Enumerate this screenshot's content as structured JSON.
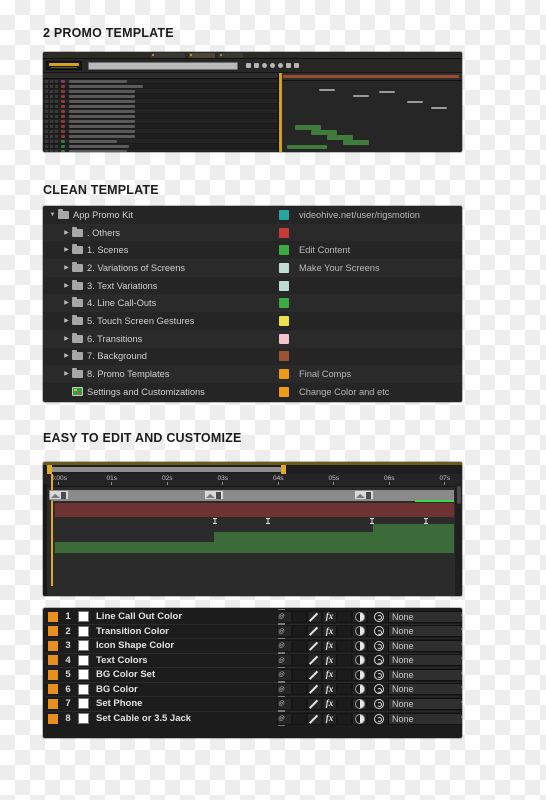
{
  "sections": [
    {
      "title": "2 PROMO TEMPLATE"
    },
    {
      "title": "CLEAN TEMPLATE"
    },
    {
      "title": "EASY TO EDIT AND CUSTOMIZE"
    }
  ],
  "ae_panel": {
    "time_display": "0:00:00:00",
    "tabs": [
      "",
      "",
      ""
    ]
  },
  "tree": {
    "rows": [
      {
        "arrow": "▼",
        "icon": "folder-icon",
        "label": "App Promo Kit",
        "swatch": "#27a5a0",
        "note": "videohive.net/user/rigsmotion",
        "indent": 1
      },
      {
        "arrow": "▶",
        "icon": "folder-icon",
        "label": ". Others",
        "swatch": "#c73b34",
        "note": "",
        "indent": 2
      },
      {
        "arrow": "▶",
        "icon": "folder-icon",
        "label": "1. Scenes",
        "swatch": "#3cab45",
        "note": "Edit Content",
        "indent": 2
      },
      {
        "arrow": "▶",
        "icon": "folder-icon",
        "label": "2. Variations of Screens",
        "swatch": "#bfdbd4",
        "note": "Make Your Screens",
        "indent": 2
      },
      {
        "arrow": "▶",
        "icon": "folder-icon",
        "label": "3. Text Variations",
        "swatch": "#bfdbd4",
        "note": "",
        "indent": 2
      },
      {
        "arrow": "▶",
        "icon": "folder-icon",
        "label": "4. Line Call-Outs",
        "swatch": "#3cab45",
        "note": "",
        "indent": 2
      },
      {
        "arrow": "▶",
        "icon": "folder-icon",
        "label": "5. Touch Screen Gestures",
        "swatch": "#e9e24c",
        "note": "",
        "indent": 2
      },
      {
        "arrow": "▶",
        "icon": "folder-icon",
        "label": "6. Transitions",
        "swatch": "#f2c3cd",
        "note": "",
        "indent": 2
      },
      {
        "arrow": "▶",
        "icon": "folder-icon",
        "label": "7. Background",
        "swatch": "#9a5333",
        "note": "",
        "indent": 2
      },
      {
        "arrow": "▶",
        "icon": "folder-icon",
        "label": "8. Promo Templates",
        "swatch": "#ef9a15",
        "note": "Final Comps",
        "indent": 2
      },
      {
        "arrow": "",
        "icon": "composition-icon",
        "label": "Settings and Customizations",
        "swatch": "#ef9a15",
        "note": "Change Color and etc",
        "indent": 2
      }
    ]
  },
  "timeline": {
    "ticks": [
      "0:00s",
      "01s",
      "02s",
      "03s",
      "04s",
      "05s",
      "06s",
      "07s"
    ]
  },
  "controls": {
    "rows": [
      {
        "num": "1",
        "label": "Line Call Out Color",
        "parent": "None"
      },
      {
        "num": "2",
        "label": "Transition Color",
        "parent": "None"
      },
      {
        "num": "3",
        "label": "Icon Shape Color",
        "parent": "None"
      },
      {
        "num": "4",
        "label": "Text Colors",
        "parent": "None"
      },
      {
        "num": "5",
        "label": "BG Color Set",
        "parent": "None"
      },
      {
        "num": "6",
        "label": "BG Color",
        "parent": "None"
      },
      {
        "num": "7",
        "label": "Set Phone",
        "parent": "None"
      },
      {
        "num": "8",
        "label": "Set Cable or 3.5 Jack",
        "parent": "None"
      }
    ]
  },
  "colors": {
    "accent_orange": "#e8901e",
    "accent_gold": "#d2a11f",
    "panel_bg": "#232323",
    "green_bar": "#3b6b38",
    "red_bar": "#6e3232"
  }
}
